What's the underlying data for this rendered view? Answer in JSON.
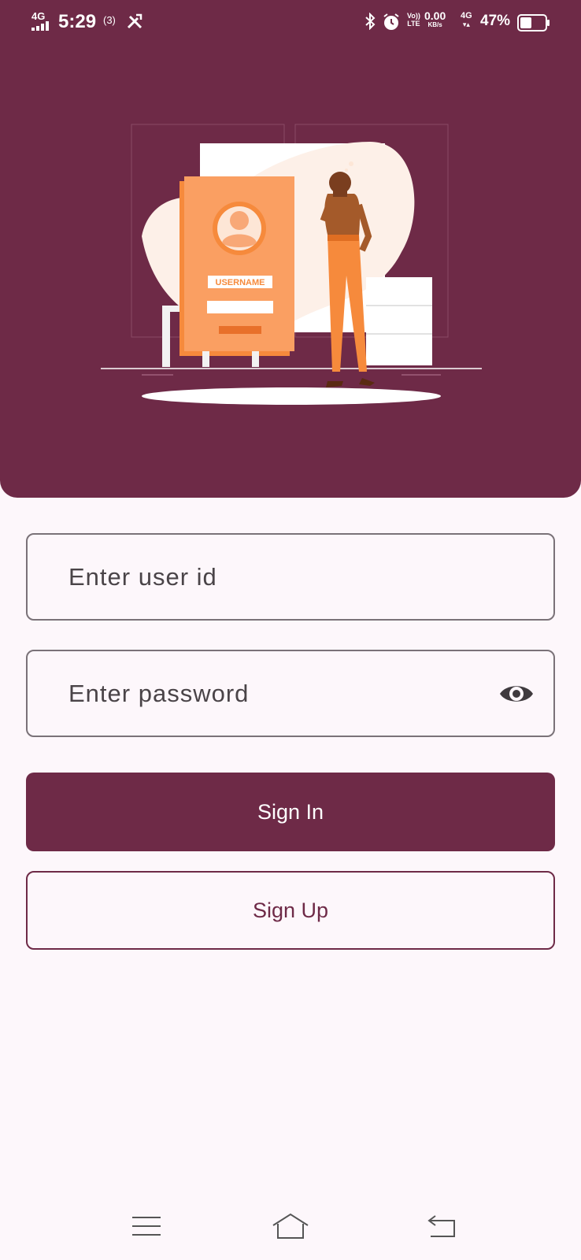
{
  "status_bar": {
    "network": "4G",
    "time": "5:29",
    "hotspot": "(3)",
    "volte_top": "Vo))",
    "volte_bottom": "LTE",
    "speed_value": "0.00",
    "speed_unit": "KB/s",
    "network2": "4G",
    "battery_percent": "47%",
    "battery_level": 0.47,
    "icons": [
      "signal-icon",
      "hotspot-icon",
      "tools-icon",
      "bluetooth-icon",
      "alarm-icon",
      "battery-icon"
    ]
  },
  "illustration": {
    "card_label": "USERNAME"
  },
  "form": {
    "user_id_placeholder": "Enter user id",
    "password_placeholder": "Enter password",
    "password_toggle_icon": "eye-icon"
  },
  "actions": {
    "sign_in_label": "Sign In",
    "sign_up_label": "Sign Up"
  },
  "nav": {
    "icons": [
      "menu-icon",
      "home-icon",
      "back-icon"
    ]
  },
  "colors": {
    "primary": "#6e2a47",
    "background": "#fdf7fb",
    "accent_orange": "#f68a3c"
  }
}
